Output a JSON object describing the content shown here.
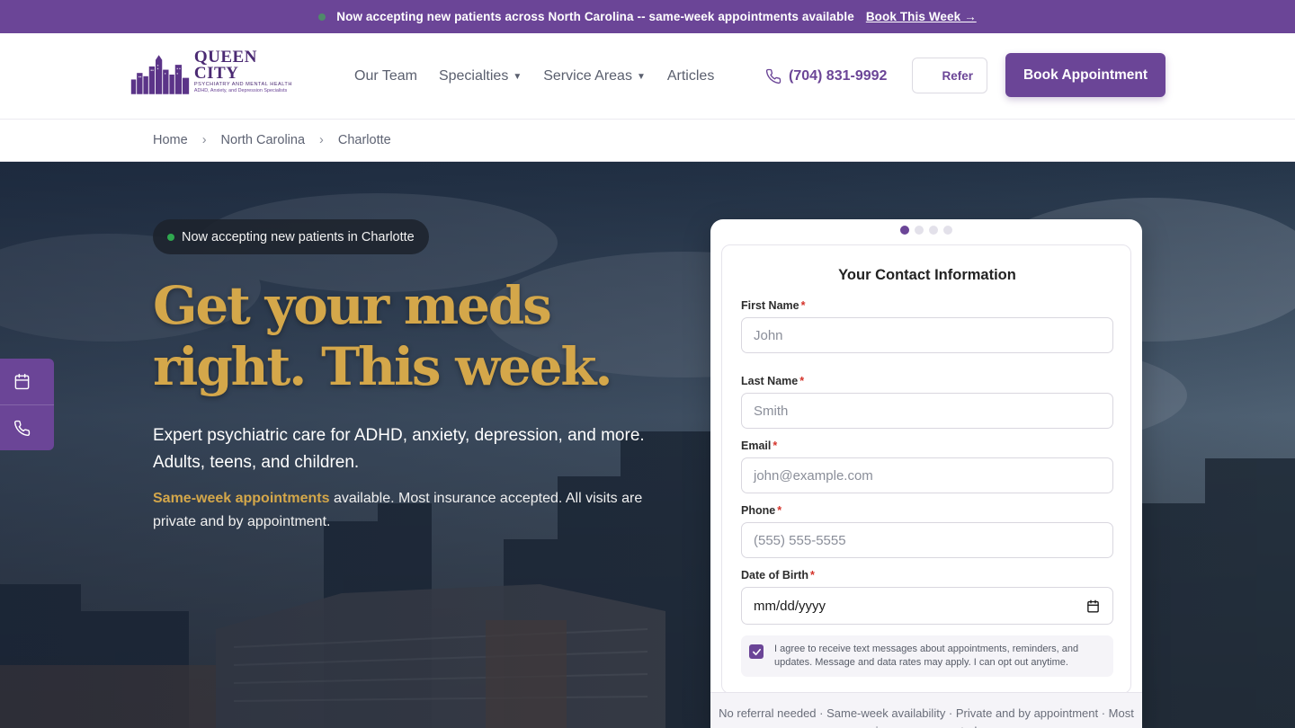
{
  "announcement": {
    "text": "Now accepting new patients across North Carolina -- same-week appointments available",
    "cta": "Book This Week →"
  },
  "header": {
    "logo": {
      "brand": "QUEEN CITY",
      "tagline": "PSYCHIATRY AND MENTAL HEALTH",
      "subtagline": "ADHD, Anxiety, and Depression Specialists"
    },
    "nav": [
      {
        "label": "Our Team",
        "dropdown": false
      },
      {
        "label": "Specialties",
        "dropdown": true
      },
      {
        "label": "Service Areas",
        "dropdown": true
      },
      {
        "label": "Articles",
        "dropdown": false
      }
    ],
    "phone": "(704) 831-9992",
    "refer_label": "Refer",
    "book_label": "Book Appointment"
  },
  "breadcrumb": [
    "Home",
    "North Carolina",
    "Charlotte"
  ],
  "hero": {
    "badge": "Now accepting new patients in Charlotte",
    "headline_line1": "Get your meds",
    "headline_line2": "right. This week.",
    "lead": "Expert psychiatric care for ADHD, anxiety, depression, and more. Adults, teens, and children.",
    "lead2_highlight": "Same-week appointments",
    "lead2_rest": " available. Most insurance accepted. All visits are private and by appointment."
  },
  "side_actions": [
    {
      "icon": "calendar-icon"
    },
    {
      "icon": "phone-icon"
    }
  ],
  "form": {
    "step_count": 4,
    "active_step": 1,
    "title": "Your Contact Information",
    "fields": {
      "first_name": {
        "label": "First Name",
        "placeholder": "John"
      },
      "last_name": {
        "label": "Last Name",
        "placeholder": "Smith"
      },
      "email": {
        "label": "Email",
        "placeholder": "john@example.com"
      },
      "phone": {
        "label": "Phone",
        "placeholder": "(555) 555-5555"
      },
      "dob": {
        "label": "Date of Birth",
        "placeholder": "mm/dd/yyyy"
      }
    },
    "required_mark": "*",
    "consent_checked": true,
    "consent_text": "I agree to receive text messages about appointments, reminders, and updates. Message and data rates may apply. I can opt out anytime.",
    "footer": "No referral needed · Same-week availability · Private and by appointment · Most insurance accepted"
  },
  "colors": {
    "brand_purple": "#6b4597",
    "gold": "#d4a74a",
    "status_green": "#2fa84f"
  }
}
